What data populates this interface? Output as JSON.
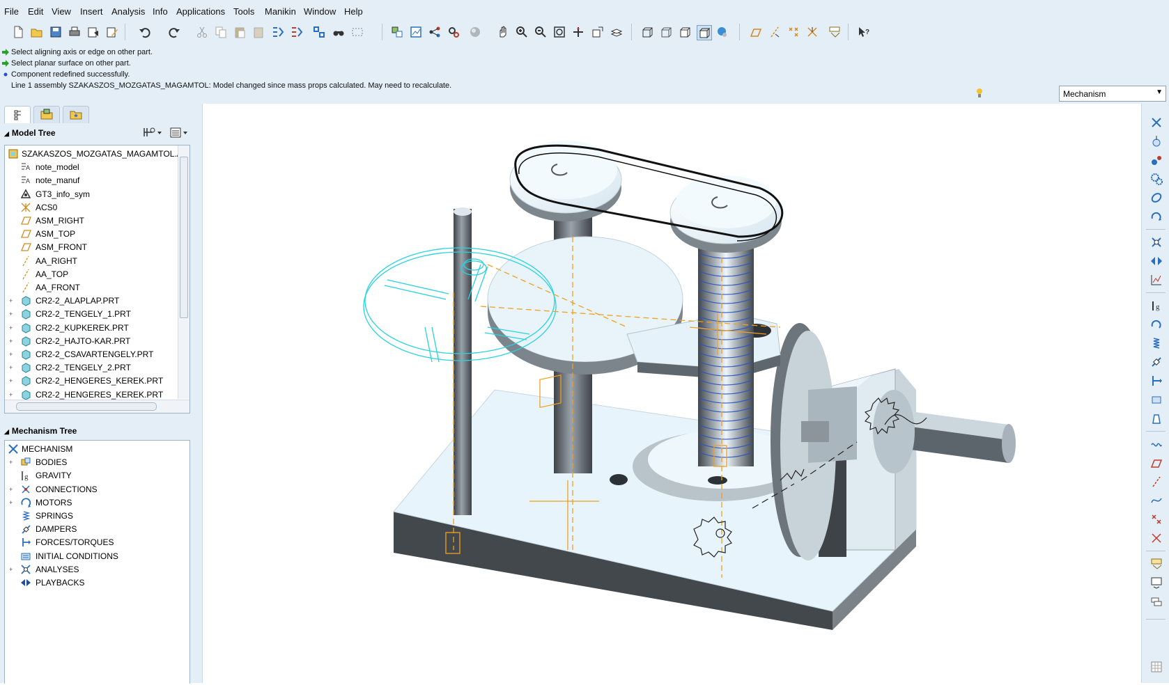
{
  "menu": [
    "File",
    "Edit",
    "View",
    "Insert",
    "Analysis",
    "Info",
    "Applications",
    "Tools",
    "Manikin",
    "Window",
    "Help"
  ],
  "messages": [
    {
      "type": "prompt",
      "text": "Select aligning axis or edge on other part."
    },
    {
      "type": "prompt",
      "text": "Select planar surface on other part."
    },
    {
      "type": "info",
      "text": "Component redefined successfully."
    },
    {
      "type": "none",
      "text": "Line 1 assembly SZAKASZOS_MOZGATAS_MAGAMTOL: Model changed since mass props calculated. May need to recalculate."
    }
  ],
  "app_selector": {
    "value": "Mechanism"
  },
  "model_tree": {
    "title": "Model Tree",
    "root": "SZAKASZOS_MOZGATAS_MAGAMTOL.AS",
    "items": [
      {
        "label": "note_model",
        "icon": "note-icon",
        "expandable": false
      },
      {
        "label": "note_manuf",
        "icon": "note-icon",
        "expandable": false
      },
      {
        "label": "GT3_info_sym",
        "icon": "symbol-icon",
        "expandable": false
      },
      {
        "label": "ACS0",
        "icon": "csys-icon",
        "expandable": false
      },
      {
        "label": "ASM_RIGHT",
        "icon": "datum-plane-icon",
        "expandable": false
      },
      {
        "label": "ASM_TOP",
        "icon": "datum-plane-icon",
        "expandable": false
      },
      {
        "label": "ASM_FRONT",
        "icon": "datum-plane-icon",
        "expandable": false
      },
      {
        "label": "AA_RIGHT",
        "icon": "datum-axis-icon",
        "expandable": false
      },
      {
        "label": "AA_TOP",
        "icon": "datum-axis-icon",
        "expandable": false
      },
      {
        "label": "AA_FRONT",
        "icon": "datum-axis-icon",
        "expandable": false
      },
      {
        "label": "CR2-2_ALAPLAP.PRT",
        "icon": "part-icon",
        "expandable": true
      },
      {
        "label": "CR2-2_TENGELY_1.PRT",
        "icon": "part-icon",
        "expandable": true
      },
      {
        "label": "CR2-2_KUPKEREK.PRT",
        "icon": "part-icon",
        "expandable": true
      },
      {
        "label": "CR2-2_HAJTO-KAR.PRT",
        "icon": "part-icon",
        "expandable": true
      },
      {
        "label": "CR2-2_CSAVARTENGELY.PRT",
        "icon": "part-icon",
        "expandable": true
      },
      {
        "label": "CR2-2_TENGELY_2.PRT",
        "icon": "part-icon",
        "expandable": true
      },
      {
        "label": "CR2-2_HENGERES_KEREK.PRT",
        "icon": "part-icon",
        "expandable": true
      },
      {
        "label": "CR2-2_HENGERES_KEREK.PRT",
        "icon": "part-icon",
        "expandable": true
      }
    ]
  },
  "mechanism_tree": {
    "title": "Mechanism Tree",
    "root": "MECHANISM",
    "items": [
      {
        "label": "BODIES",
        "icon": "bodies-icon",
        "expandable": true
      },
      {
        "label": "GRAVITY",
        "icon": "gravity-icon",
        "expandable": false
      },
      {
        "label": "CONNECTIONS",
        "icon": "connections-icon",
        "expandable": true
      },
      {
        "label": "MOTORS",
        "icon": "motor-icon",
        "expandable": true
      },
      {
        "label": "SPRINGS",
        "icon": "spring-icon",
        "expandable": false
      },
      {
        "label": "DAMPERS",
        "icon": "damper-icon",
        "expandable": false
      },
      {
        "label": "FORCES/TORQUES",
        "icon": "force-icon",
        "expandable": false
      },
      {
        "label": "INITIAL CONDITIONS",
        "icon": "initial-conditions-icon",
        "expandable": false
      },
      {
        "label": "ANALYSES",
        "icon": "analysis-icon",
        "expandable": true
      },
      {
        "label": "PLAYBACKS",
        "icon": "playback-icon",
        "expandable": false
      }
    ]
  },
  "colors": {
    "chrome": "#e4eef7",
    "part_light": "#e6f3fa",
    "part_dark": "#4e5459",
    "highlight": "#27d3e0",
    "datum": "#f0a020"
  }
}
